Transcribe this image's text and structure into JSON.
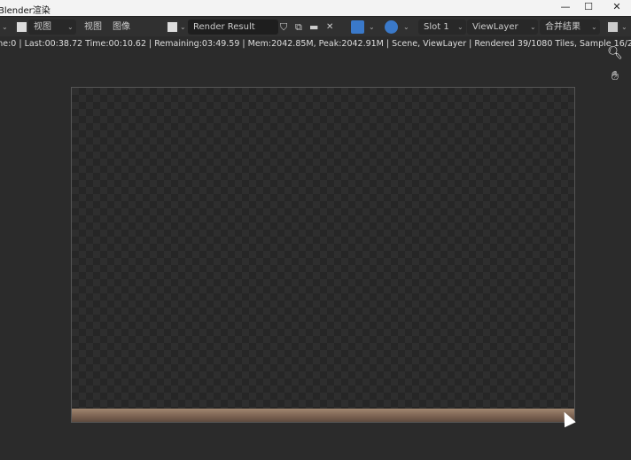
{
  "window": {
    "title": "Blender渲染",
    "minimize": "—",
    "maximize": "☐",
    "close": "✕"
  },
  "header": {
    "view_mode": "视图",
    "menus": [
      "视图",
      "图像"
    ],
    "image_name": "Render Result",
    "slot": "Slot 1",
    "view_layer": "ViewLayer",
    "pass": "合并结果",
    "accent": "#3a79c9"
  },
  "status": {
    "text": "me:0 | Last:00:38.72 Time:00:10.62 | Remaining:03:49.59 | Mem:2042.85M, Peak:2042.91M | Scene, ViewLayer | Rendered 39/1080 Tiles, Sample 16/2"
  },
  "side_tools": [
    "zoom-icon",
    "hand-icon"
  ]
}
